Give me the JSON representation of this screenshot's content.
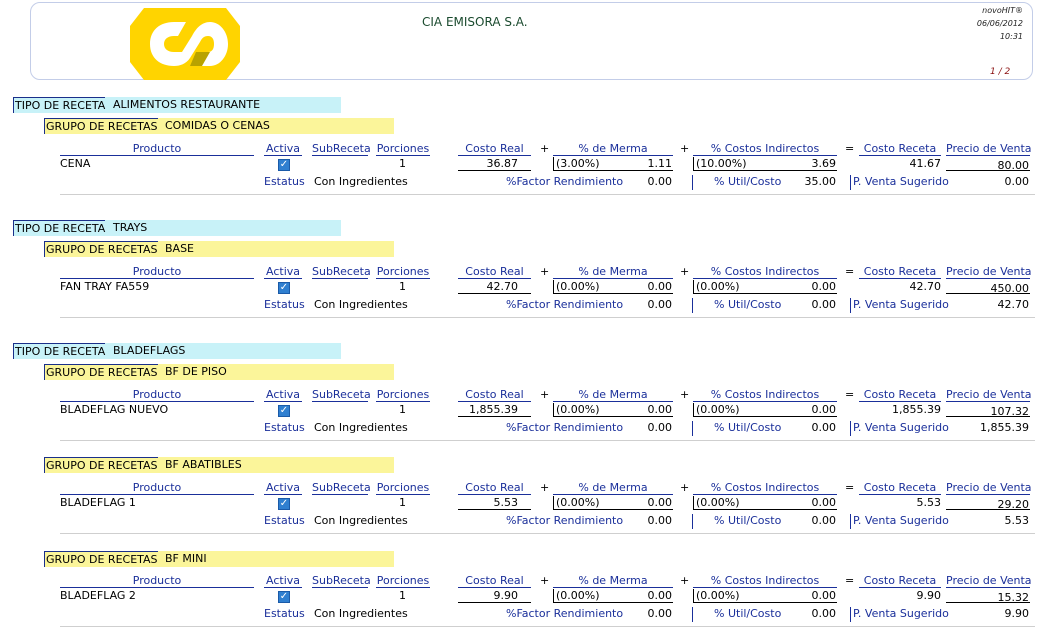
{
  "header": {
    "company": "CIA EMISORA S.A.",
    "app": "novoHIT®",
    "date": "06/06/2012",
    "time": "10:31",
    "page": "1 / 2"
  },
  "labels": {
    "tipo": "TIPO DE RECETA",
    "grupo": "GRUPO DE RECETAS",
    "producto": "Producto",
    "activa": "Activa",
    "subreceta": "SubReceta",
    "porciones": "Porciones",
    "costo_real": "Costo Real",
    "plus": "+",
    "eq": "=",
    "merma": "% de Merma",
    "costos_ind": "% Costos Indirectos",
    "costo_receta": "Costo Receta",
    "precio_venta": "Precio de Venta",
    "estatus": "Estatus",
    "con_ingredientes": "Con Ingredientes",
    "factor": "%Factor Rendimiento",
    "util": "% Util/Costo",
    "sugerido": "P. Venta Sugerido"
  },
  "colors": {
    "label_blue": "#1a2f9a",
    "tipo_bg": "#c8f2f8",
    "grupo_bg": "#fbf59a",
    "logo_yellow": "#ffd400"
  },
  "tipos": [
    {
      "name": "ALIMENTOS RESTAURANTE"
    },
    {
      "name": "TRAYS"
    },
    {
      "name": "BLADEFLAGS"
    }
  ],
  "grupos": [
    {
      "name": "COMIDAS O CENAS"
    },
    {
      "name": "BASE"
    },
    {
      "name": "BF DE PISO"
    },
    {
      "name": "BF ABATIBLES"
    },
    {
      "name": "BF MINI"
    }
  ],
  "recipes": [
    {
      "producto": "CENA",
      "porciones": "1",
      "costo_real": "36.87",
      "merma_pct": "(3.00%)",
      "merma_val": "1.11",
      "ind_pct": "(10.00%)",
      "ind_val": "3.69",
      "costo_receta": "41.67",
      "precio": "80.00",
      "factor": "0.00",
      "util": "35.00",
      "sugerido": "0.00"
    },
    {
      "producto": "FAN TRAY FA559",
      "porciones": "1",
      "costo_real": "42.70",
      "merma_pct": "(0.00%)",
      "merma_val": "0.00",
      "ind_pct": "(0.00%)",
      "ind_val": "0.00",
      "costo_receta": "42.70",
      "precio": "450.00",
      "factor": "0.00",
      "util": "0.00",
      "sugerido": "42.70"
    },
    {
      "producto": "BLADEFLAG  NUEVO",
      "porciones": "1",
      "costo_real": "1,855.39",
      "merma_pct": "(0.00%)",
      "merma_val": "0.00",
      "ind_pct": "(0.00%)",
      "ind_val": "0.00",
      "costo_receta": "1,855.39",
      "precio": "107.32",
      "factor": "0.00",
      "util": "0.00",
      "sugerido": "1,855.39"
    },
    {
      "producto": "BLADEFLAG 1",
      "porciones": "1",
      "costo_real": "5.53",
      "merma_pct": "(0.00%)",
      "merma_val": "0.00",
      "ind_pct": "(0.00%)",
      "ind_val": "0.00",
      "costo_receta": "5.53",
      "precio": "29.20",
      "factor": "0.00",
      "util": "0.00",
      "sugerido": "5.53"
    },
    {
      "producto": "BLADEFLAG 2",
      "porciones": "1",
      "costo_real": "9.90",
      "merma_pct": "(0.00%)",
      "merma_val": "0.00",
      "ind_pct": "(0.00%)",
      "ind_val": "0.00",
      "costo_receta": "9.90",
      "precio": "15.32",
      "factor": "0.00",
      "util": "0.00",
      "sugerido": "9.90"
    }
  ]
}
